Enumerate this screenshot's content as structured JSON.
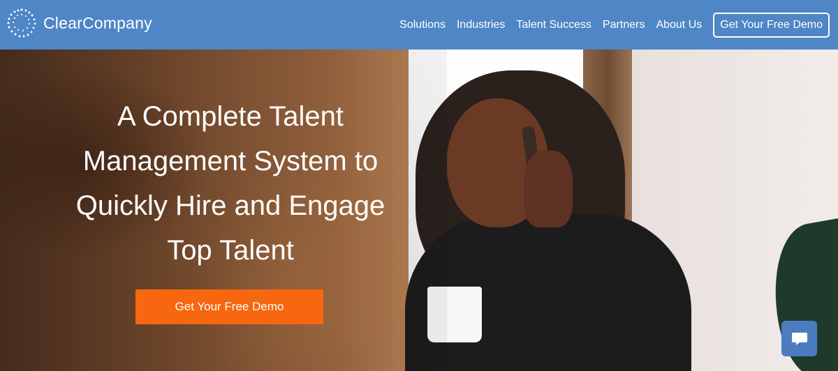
{
  "header": {
    "logo_text": "ClearCompany",
    "nav": [
      "Solutions",
      "Industries",
      "Talent Success",
      "Partners",
      "About Us"
    ],
    "cta_label": "Get Your Free Demo"
  },
  "hero": {
    "headline_lines": [
      "A Complete Talent",
      "Management System to",
      "Quickly Hire and Engage",
      "Top Talent"
    ],
    "cta_label": "Get Your Free Demo"
  },
  "chat": {
    "icon": "chat-bubble-icon"
  },
  "colors": {
    "header_bg": "#4f86c6",
    "cta_bg": "#f6670f",
    "chat_bg": "#4a7cbf"
  }
}
